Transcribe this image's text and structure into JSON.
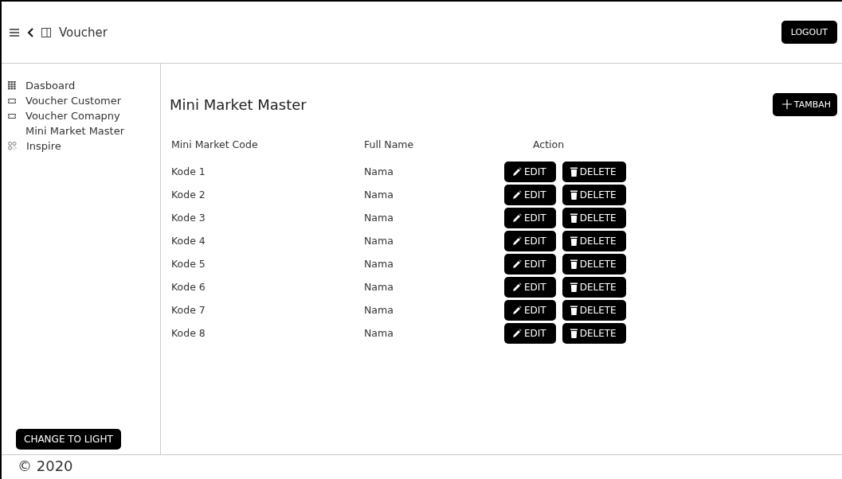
{
  "header": {
    "title": "Voucher",
    "logout": "LOGOUT"
  },
  "sidebar": {
    "items": [
      {
        "label": "Dasboard",
        "kind": "grid"
      },
      {
        "label": "Voucher Customer",
        "kind": "ticket"
      },
      {
        "label": "Voucher Comapny",
        "kind": "ticket"
      },
      {
        "label": "Mini Market Master",
        "kind": "plain"
      },
      {
        "label": "Inspire",
        "kind": "cluster"
      }
    ],
    "theme_button": "CHANGE TO LIGHT"
  },
  "page": {
    "title": "Mini Market Master",
    "add_button": "TAMBAH"
  },
  "table": {
    "columns": [
      "Mini Market Code",
      "Full Name",
      "Action"
    ],
    "rows": [
      {
        "code": "Kode 1",
        "name": "Nama",
        "edit": "EDIT",
        "delete": "DELETE"
      },
      {
        "code": "Kode 2",
        "name": "Nama",
        "edit": "EDIT",
        "delete": "DELETE"
      },
      {
        "code": "Kode 3",
        "name": "Nama",
        "edit": "EDIT",
        "delete": "DELETE"
      },
      {
        "code": "Kode 4",
        "name": "Nama",
        "edit": "EDIT",
        "delete": "DELETE"
      },
      {
        "code": "Kode 5",
        "name": "Nama",
        "edit": "EDIT",
        "delete": "DELETE"
      },
      {
        "code": "Kode 6",
        "name": "Nama",
        "edit": "EDIT",
        "delete": "DELETE"
      },
      {
        "code": "Kode 7",
        "name": "Nama",
        "edit": "EDIT",
        "delete": "DELETE"
      },
      {
        "code": "Kode 8",
        "name": "Nama",
        "edit": "EDIT",
        "delete": "DELETE"
      }
    ]
  },
  "footer": "© 2020"
}
